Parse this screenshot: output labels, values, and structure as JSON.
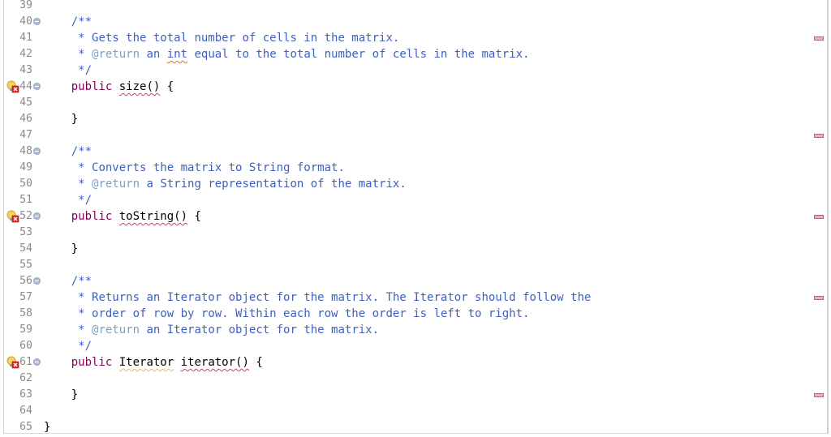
{
  "editor": {
    "language": "java",
    "colors": {
      "comment": "#3f5fbf",
      "javadoc_tag": "#7f9fbf",
      "keyword": "#7f0055",
      "line_number": "#8a8a8a",
      "error_underline": "#e0308a",
      "warning_underline": "#f0b840",
      "overview_marker": "#f4a8d0"
    },
    "lines": [
      {
        "num": "39",
        "segments": []
      },
      {
        "num": "40",
        "fold": true,
        "segments": [
          {
            "t": "    "
          },
          {
            "t": "/**",
            "c": "cm"
          }
        ]
      },
      {
        "num": "41",
        "segments": [
          {
            "t": "     "
          },
          {
            "t": "* Gets the total number of cells in the matrix.",
            "c": "cm"
          }
        ]
      },
      {
        "num": "42",
        "segments": [
          {
            "t": "     "
          },
          {
            "t": "* ",
            "c": "cm"
          },
          {
            "t": "@return",
            "c": "tag"
          },
          {
            "t": " an ",
            "c": "cm"
          },
          {
            "t": "int",
            "c": "cm spell"
          },
          {
            "t": " equal to the total number of cells in the matrix.",
            "c": "cm"
          }
        ]
      },
      {
        "num": "43",
        "segments": [
          {
            "t": "     "
          },
          {
            "t": "*/",
            "c": "cm"
          }
        ]
      },
      {
        "num": "44",
        "fold": true,
        "marker": "error-warning-icon",
        "segments": [
          {
            "t": "    "
          },
          {
            "t": "public",
            "c": "kw"
          },
          {
            "t": " "
          },
          {
            "t": "size()",
            "c": "err"
          },
          {
            "t": " {"
          }
        ]
      },
      {
        "num": "45",
        "segments": []
      },
      {
        "num": "46",
        "segments": [
          {
            "t": "    "
          },
          {
            "t": "}"
          }
        ]
      },
      {
        "num": "47",
        "segments": []
      },
      {
        "num": "48",
        "fold": true,
        "segments": [
          {
            "t": "    "
          },
          {
            "t": "/**",
            "c": "cm"
          }
        ]
      },
      {
        "num": "49",
        "segments": [
          {
            "t": "     "
          },
          {
            "t": "* Converts the matrix to String format.",
            "c": "cm"
          }
        ]
      },
      {
        "num": "50",
        "segments": [
          {
            "t": "     "
          },
          {
            "t": "* ",
            "c": "cm"
          },
          {
            "t": "@return",
            "c": "tag"
          },
          {
            "t": " a String representation of the matrix.",
            "c": "cm"
          }
        ]
      },
      {
        "num": "51",
        "segments": [
          {
            "t": "     "
          },
          {
            "t": "*/",
            "c": "cm"
          }
        ]
      },
      {
        "num": "52",
        "fold": true,
        "marker": "error-warning-icon",
        "segments": [
          {
            "t": "    "
          },
          {
            "t": "public",
            "c": "kw"
          },
          {
            "t": " "
          },
          {
            "t": "toString()",
            "c": "err"
          },
          {
            "t": " {"
          }
        ]
      },
      {
        "num": "53",
        "segments": []
      },
      {
        "num": "54",
        "segments": [
          {
            "t": "    "
          },
          {
            "t": "}"
          }
        ]
      },
      {
        "num": "55",
        "segments": []
      },
      {
        "num": "56",
        "fold": true,
        "segments": [
          {
            "t": "    "
          },
          {
            "t": "/**",
            "c": "cm"
          }
        ]
      },
      {
        "num": "57",
        "segments": [
          {
            "t": "     "
          },
          {
            "t": "* Returns an Iterator object for the matrix. The Iterator should follow the",
            "c": "cm"
          }
        ]
      },
      {
        "num": "58",
        "segments": [
          {
            "t": "     "
          },
          {
            "t": "* order of row by row. Within each row the order is left to right.",
            "c": "cm"
          }
        ]
      },
      {
        "num": "59",
        "segments": [
          {
            "t": "     "
          },
          {
            "t": "* ",
            "c": "cm"
          },
          {
            "t": "@return",
            "c": "tag"
          },
          {
            "t": " an Iterator object for the matrix.",
            "c": "cm"
          }
        ]
      },
      {
        "num": "60",
        "segments": [
          {
            "t": "     "
          },
          {
            "t": "*/",
            "c": "cm"
          }
        ]
      },
      {
        "num": "61",
        "fold": true,
        "marker": "error-warning-icon",
        "segments": [
          {
            "t": "    "
          },
          {
            "t": "public",
            "c": "kw"
          },
          {
            "t": " "
          },
          {
            "t": "Iterator",
            "c": "warn"
          },
          {
            "t": " "
          },
          {
            "t": "iterator()",
            "c": "err"
          },
          {
            "t": " {"
          }
        ]
      },
      {
        "num": "62",
        "segments": []
      },
      {
        "num": "63",
        "segments": [
          {
            "t": "    "
          },
          {
            "t": "}"
          }
        ]
      },
      {
        "num": "64",
        "segments": []
      },
      {
        "num": "65",
        "segments": [
          {
            "t": "}"
          }
        ]
      }
    ],
    "overview_markers_at_lines": [
      "41",
      "47",
      "52",
      "57",
      "63"
    ]
  }
}
